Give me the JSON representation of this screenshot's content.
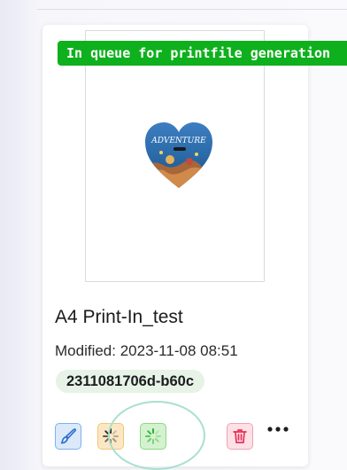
{
  "card": {
    "status_badge": "In queue for printfile generation",
    "title": "A4 Print-In_test",
    "modified": "Modified: 2023-11-08 08:51",
    "order_id": "2311081706d-b60c",
    "thumbnail_text": "ADVENTURE"
  },
  "icons": {
    "edit": "brush-icon",
    "processing_1": "spinner-icon",
    "processing_2": "spinner-icon",
    "delete": "trash-icon",
    "more": "more-horizontal-icon"
  },
  "colors": {
    "status_green": "#0fb01d",
    "order_badge_bg": "#e6f3e6",
    "edit_bg": "#dbe9fa",
    "edit_border": "#7fb0ec",
    "processing_1_bg": "#fbe7c4",
    "processing_2_bg": "#d4f2cf",
    "delete_bg": "#fde1e6",
    "delete_icon": "#e8305a"
  }
}
